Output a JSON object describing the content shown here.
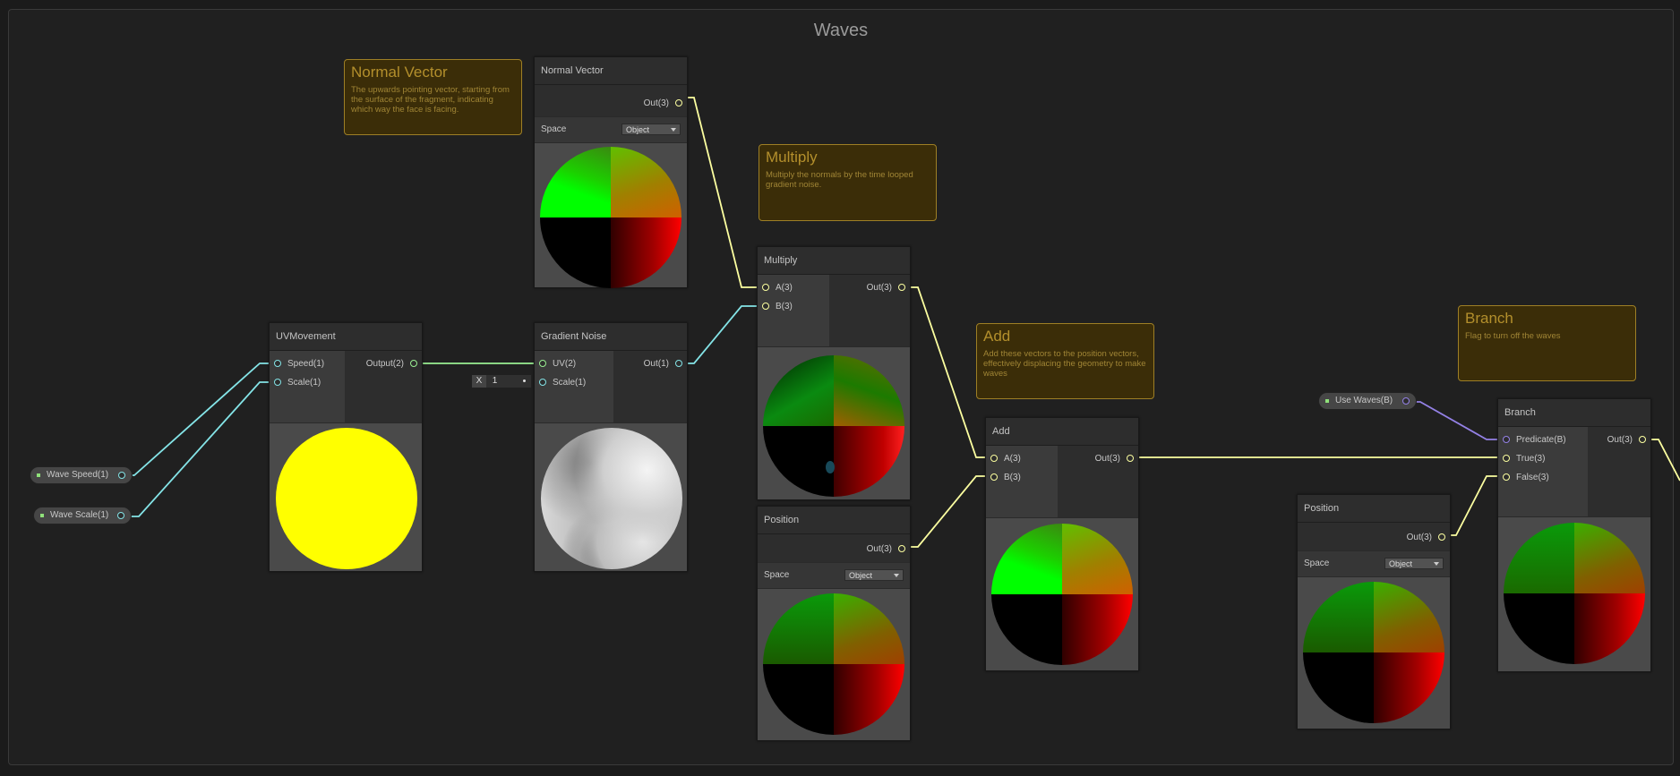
{
  "group": {
    "title": "Waves"
  },
  "colors": {
    "wire_vector3": "#fcffa0",
    "wire_float": "#84e4e7",
    "wire_vector2": "#9aef92",
    "wire_boolean": "#9481e6",
    "sticky_bg": "#3b2d08",
    "sticky_border": "#9e7f25"
  },
  "sticky_notes": {
    "normal_vector": {
      "title": "Normal Vector",
      "body": "The upwards pointing  vector, starting from the surface of the fragment, indicating which way the face is facing."
    },
    "multiply": {
      "title": "Multiply",
      "body": "Multiply the normals by the time looped gradient noise."
    },
    "add": {
      "title": "Add",
      "body": "Add these vectors to the position vectors, effectively displacing the geometry to make waves"
    },
    "branch": {
      "title": "Branch",
      "body": "Flag to turn off the waves"
    }
  },
  "properties": {
    "wave_speed": "Wave Speed(1)",
    "wave_scale": "Wave Scale(1)",
    "use_waves": "Use Waves(B)"
  },
  "nodes": {
    "normal_vector": {
      "title": "Normal Vector",
      "out": "Out(3)",
      "space_label": "Space",
      "space_value": "Object"
    },
    "uvmovement": {
      "title": "UVMovement",
      "in_speed": "Speed(1)",
      "in_scale": "Scale(1)",
      "out": "Output(2)"
    },
    "gradient_noise": {
      "title": "Gradient Noise",
      "in_uv": "UV(2)",
      "in_scale": "Scale(1)",
      "out": "Out(1)",
      "scale_field_label": "X",
      "scale_field_value": "1"
    },
    "multiply": {
      "title": "Multiply",
      "in_a": "A(3)",
      "in_b": "B(3)",
      "out": "Out(3)"
    },
    "position1": {
      "title": "Position",
      "out": "Out(3)",
      "space_label": "Space",
      "space_value": "Object"
    },
    "add": {
      "title": "Add",
      "in_a": "A(3)",
      "in_b": "B(3)",
      "out": "Out(3)"
    },
    "position2": {
      "title": "Position",
      "out": "Out(3)",
      "space_label": "Space",
      "space_value": "Object"
    },
    "branch": {
      "title": "Branch",
      "in_predicate": "Predicate(B)",
      "in_true": "True(3)",
      "in_false": "False(3)",
      "out": "Out(3)"
    }
  },
  "icons": {
    "port": "port-dot-icon",
    "dropdown": "chevron-down-icon",
    "property_pin": "property-pin-icon"
  }
}
